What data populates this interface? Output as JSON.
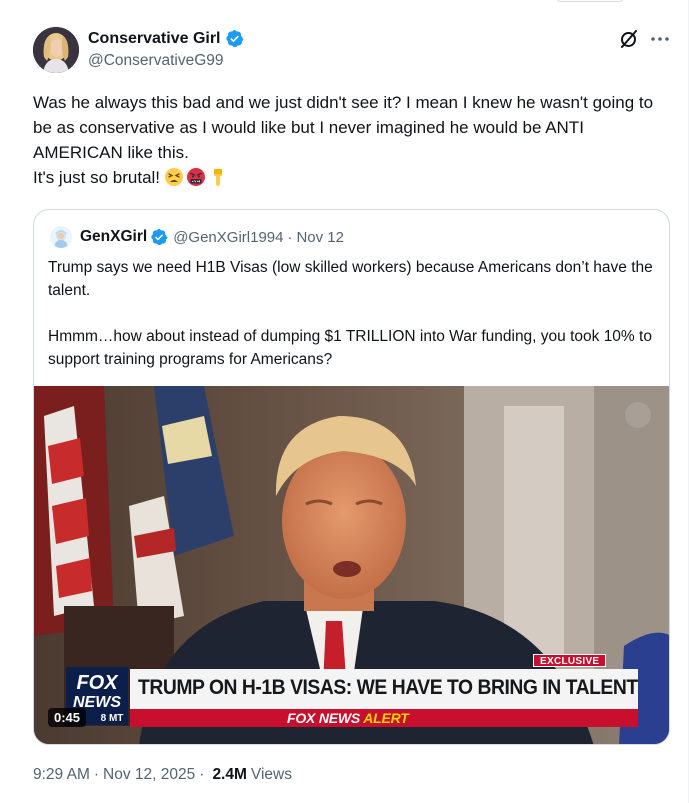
{
  "author": {
    "display_name": "Conservative Girl",
    "handle": "@ConservativeG99"
  },
  "tweet": {
    "text": "Was he always this bad and we just didn't see it? I mean I knew he wasn't going to be as conservative as I would like but I never imagined he would be ANTI AMERICAN like this.\nIt's just so brutal!",
    "emojis": [
      "tired-face-emoji",
      "cursing-face-emoji",
      "pointing-down-emoji"
    ]
  },
  "quote": {
    "display_name": "GenXGirl",
    "handle": "@GenXGirl1994",
    "separator": "·",
    "date": "Nov 12",
    "text": "Trump says we need H1B Visas (low skilled workers) because Americans don’t have the talent.\n\nHmmm…how about instead of dumping $1 TRILLION into War funding, you took 10% to support training programs for Americans?",
    "media": {
      "duration": "0:45",
      "exclusive_label": "EXCLUSIVE",
      "headline": "TRUMP ON H-1B VISAS: WE HAVE TO BRING IN TALENT",
      "alert_brand": "FOX NEWS",
      "alert_word": "ALERT",
      "logo_text_1": "FOX",
      "logo_text_2": "NEWS",
      "logo_time": "8 MT"
    }
  },
  "meta": {
    "time": "9:29 AM",
    "separator": "·",
    "date": "Nov 12, 2025",
    "separator2": "·",
    "views_count": "2.4M",
    "views_label": "Views"
  },
  "colors": {
    "verified_blue": "#1d9bf0",
    "text_primary": "#0f1419",
    "text_secondary": "#536471",
    "fox_red": "#c8102e"
  }
}
